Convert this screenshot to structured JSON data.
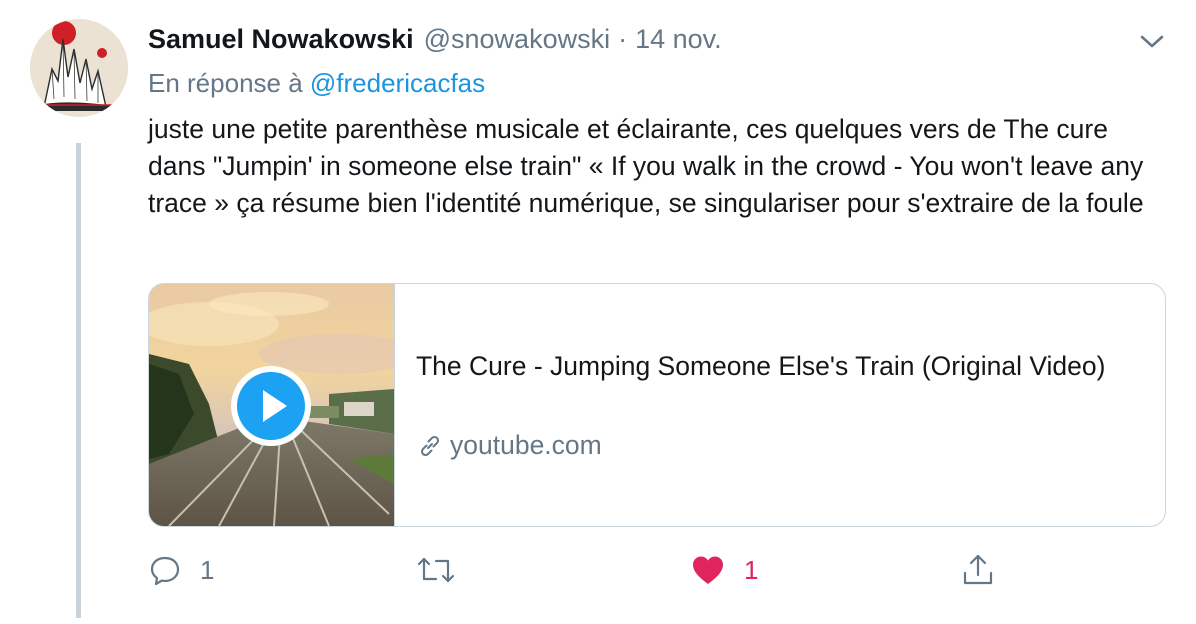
{
  "tweet": {
    "author_name": "Samuel Nowakowski",
    "handle": "@snowakowski",
    "separator": "·",
    "date": "14 nov.",
    "reply_prefix": "En réponse à",
    "reply_to": "@fredericacfas",
    "text": "juste une petite parenthèse musicale et éclairante, ces quelques vers de The cure dans \"Jumpin' in someone else train\" « If you walk in the crowd - You won't leave any trace » ça résume bien l'identité numérique, se singulariser pour s'extraire de la foule"
  },
  "card": {
    "title": "The Cure - Jumping Someone Else's Train (Original Video)",
    "domain": "youtube.com"
  },
  "actions": {
    "reply_count": "1",
    "retweet_count": "",
    "like_count": "1"
  },
  "colors": {
    "link": "#1b95e0",
    "muted": "#657786",
    "like": "#e0245e",
    "play_button": "#1da1f2"
  },
  "icons": {
    "caret": "chevron-down-icon",
    "link": "link-icon",
    "reply": "reply-icon",
    "retweet": "retweet-icon",
    "like": "heart-icon",
    "share": "share-icon",
    "play": "play-icon"
  }
}
